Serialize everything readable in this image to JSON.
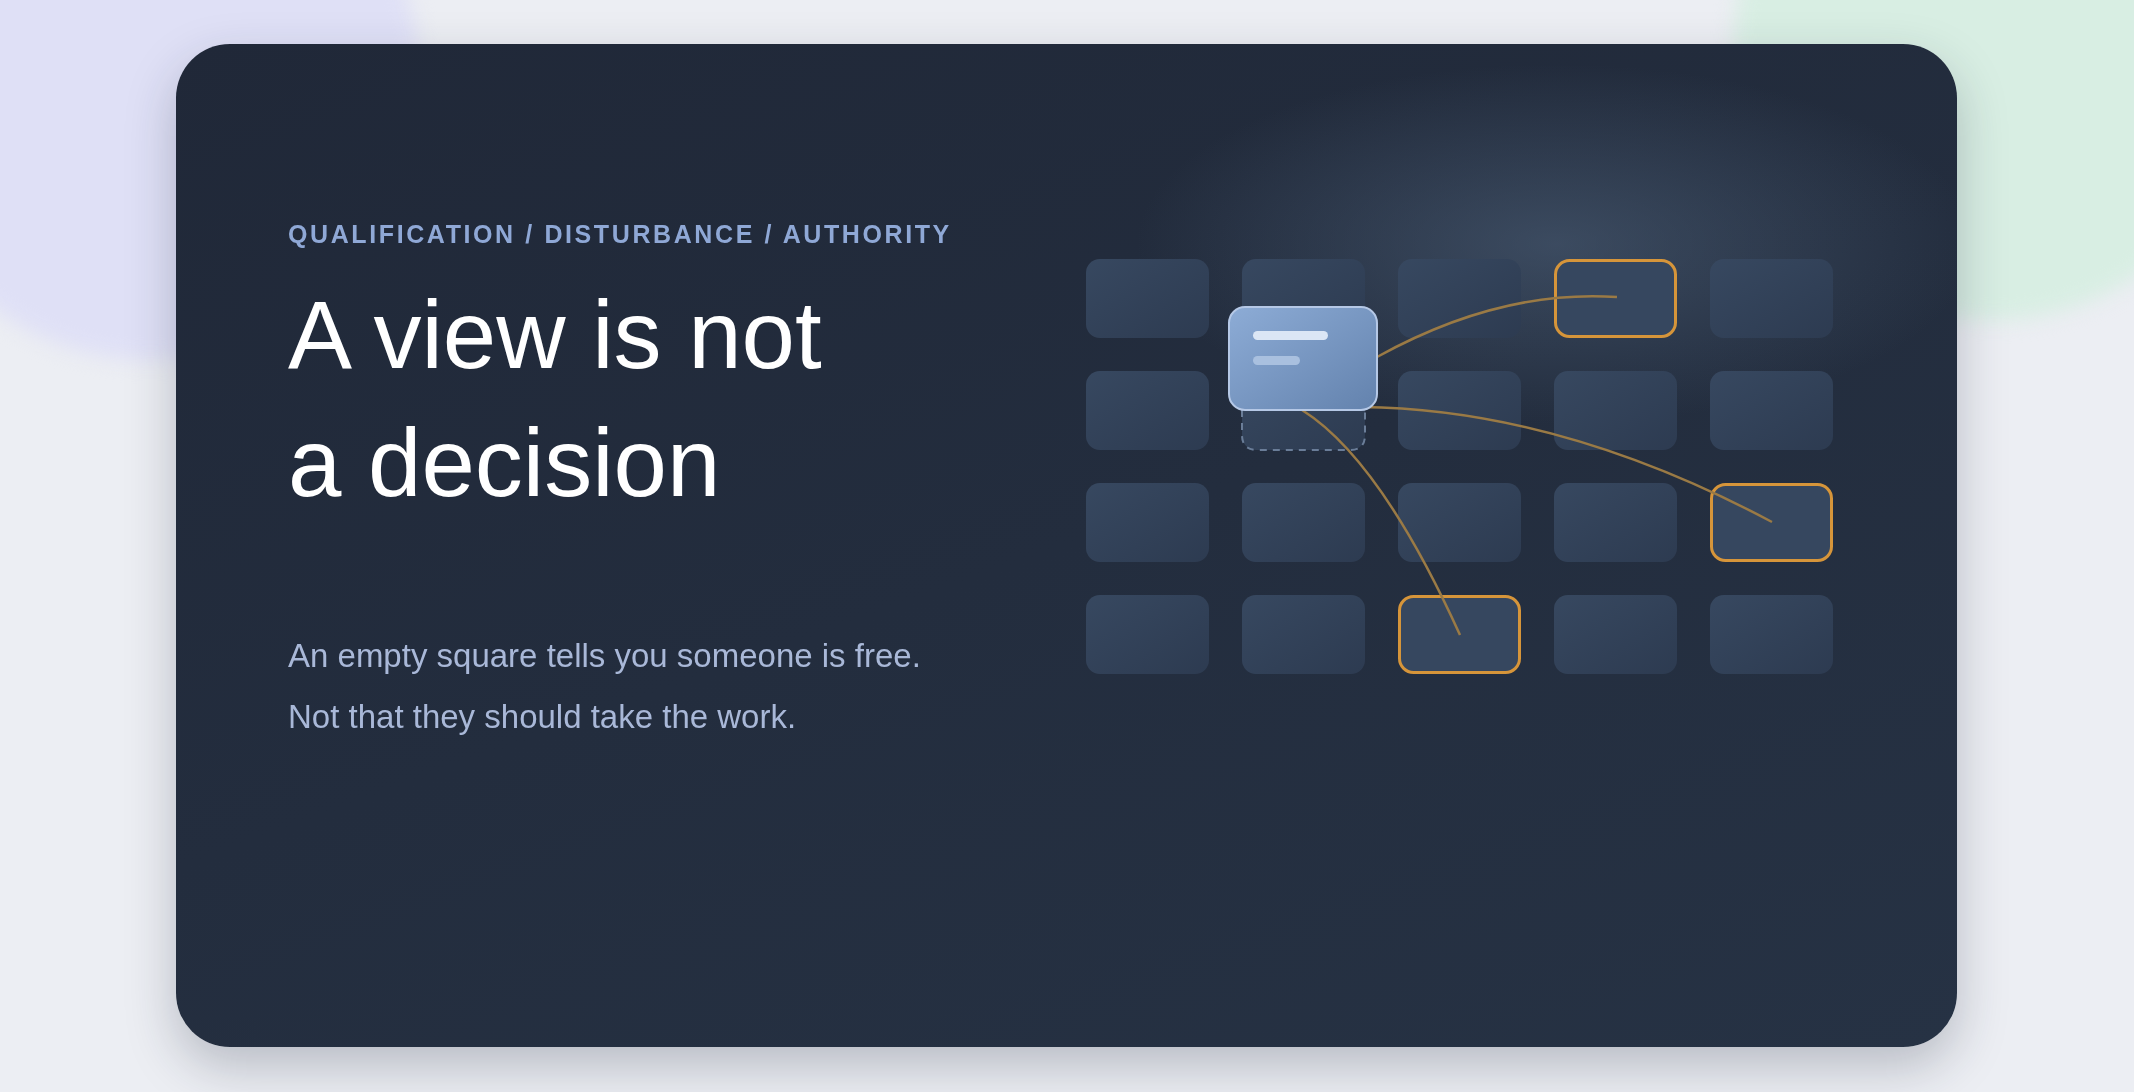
{
  "eyebrow": "QUALIFICATION / DISTURBANCE / AUTHORITY",
  "title_lines": [
    "A view is not",
    "a decision"
  ],
  "body_lines": [
    "An empty square tells you someone is free.",
    "Not that they should take the work."
  ],
  "grid": {
    "rows": [
      {
        "cells": [
          {
            "highlighted": false
          },
          {
            "highlighted": false
          },
          {
            "highlighted": false
          },
          {
            "highlighted": true
          },
          {
            "highlighted": false
          }
        ]
      },
      {
        "cells": [
          {
            "highlighted": false
          },
          {
            "highlighted": false
          },
          {
            "highlighted": false
          },
          {
            "highlighted": false
          },
          {
            "highlighted": false
          }
        ]
      },
      {
        "cells": [
          {
            "highlighted": false
          },
          {
            "highlighted": false
          },
          {
            "highlighted": false
          },
          {
            "highlighted": false
          },
          {
            "highlighted": true
          }
        ]
      },
      {
        "cells": [
          {
            "highlighted": false
          },
          {
            "highlighted": false
          },
          {
            "highlighted": true
          },
          {
            "highlighted": false
          },
          {
            "highlighted": false
          }
        ]
      }
    ]
  }
}
